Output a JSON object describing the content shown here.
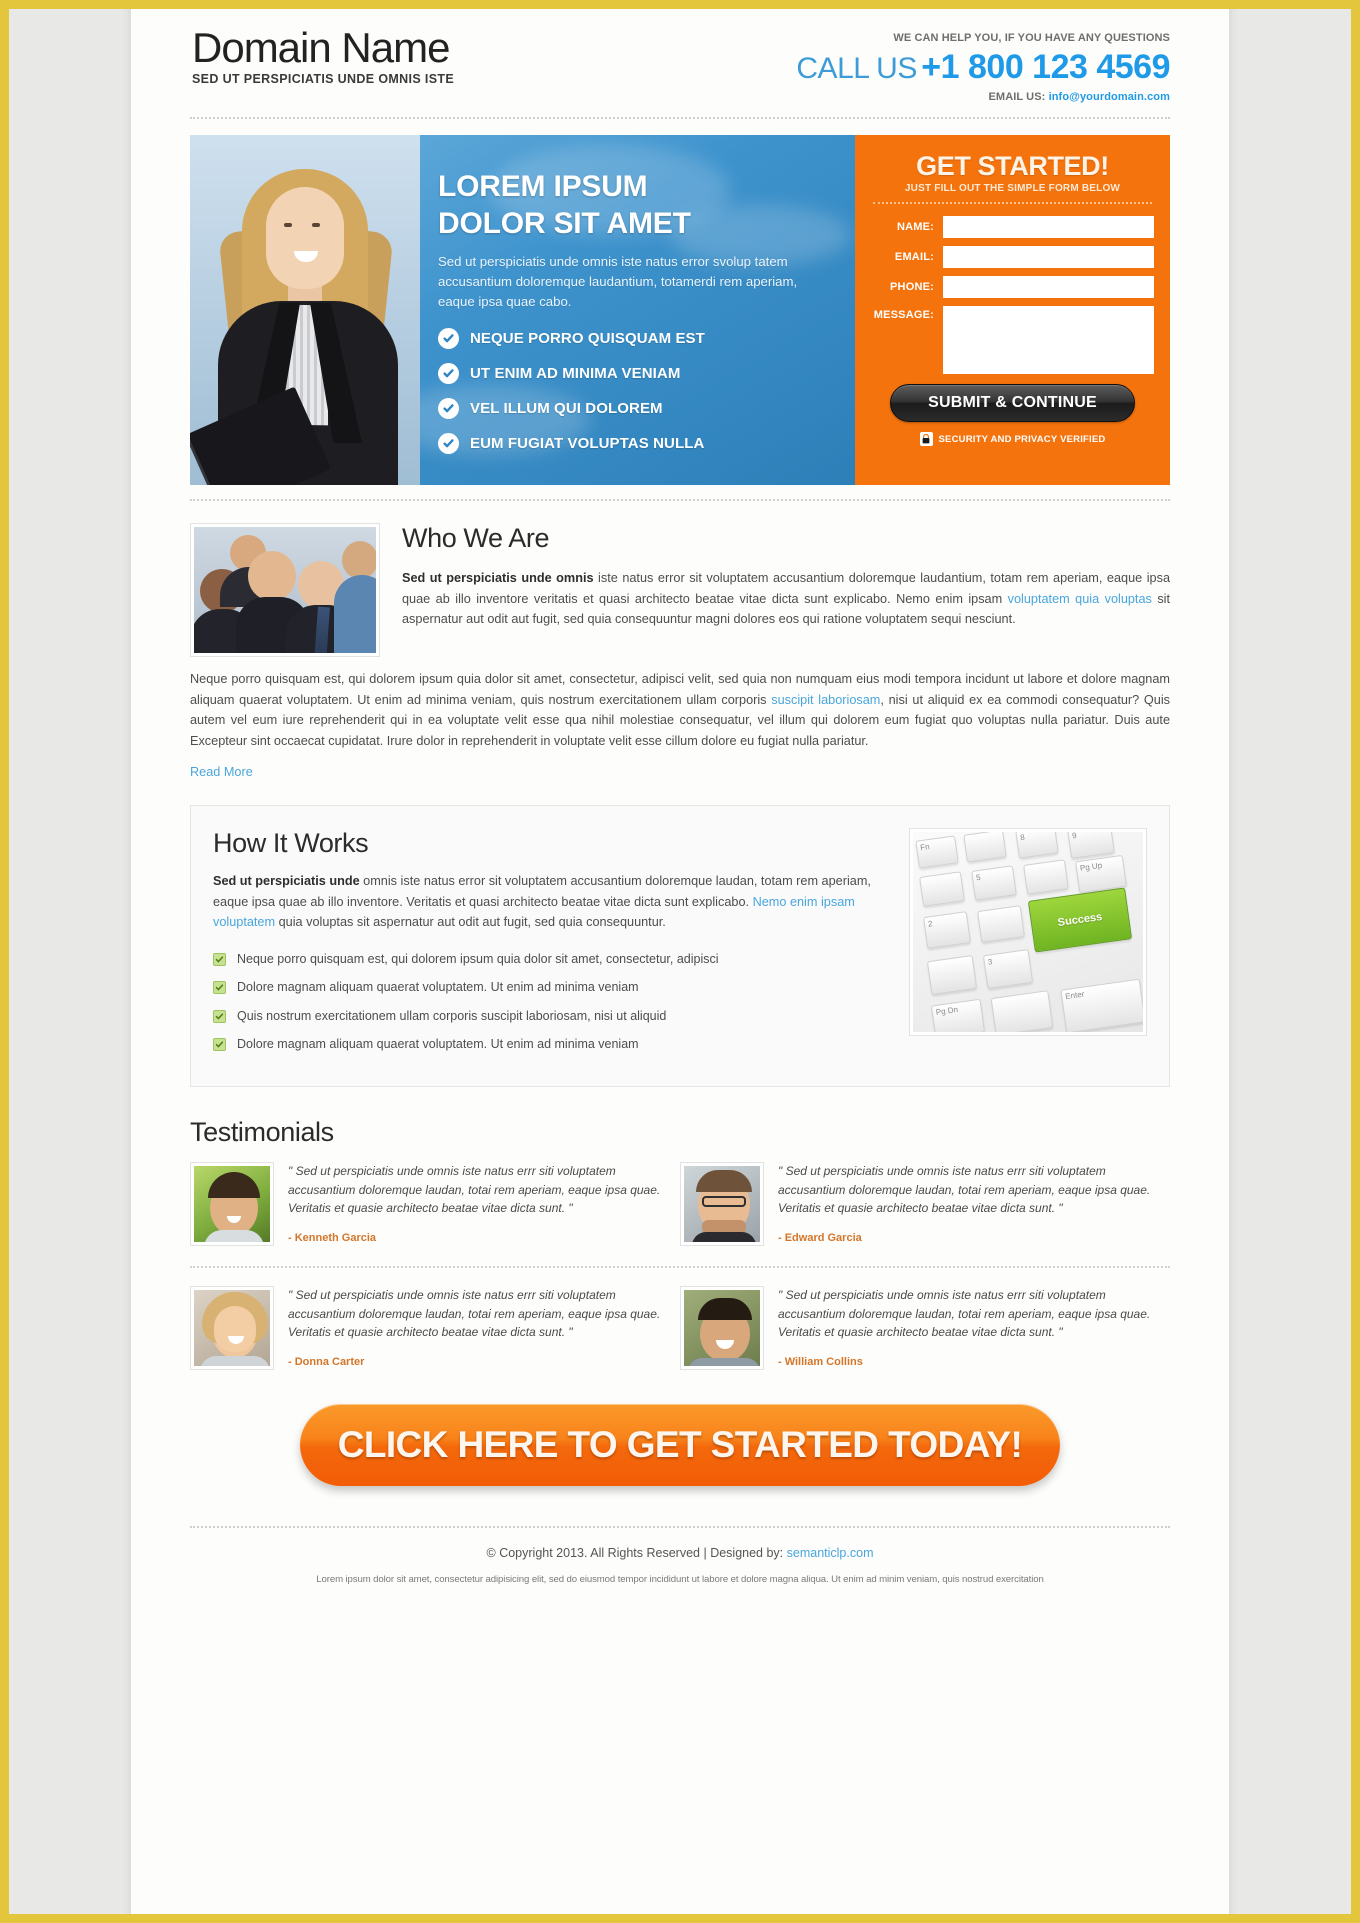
{
  "header": {
    "logo_title": "Domain Name",
    "logo_subtitle": "SED UT PERSPICIATIS UNDE OMNIS ISTE",
    "help_text": "WE CAN HELP YOU, IF YOU HAVE ANY QUESTIONS",
    "call_us_label": "CALL US",
    "phone": "+1 800 123 4569",
    "email_label": "EMAIL US:",
    "email": "info@yourdomain.com"
  },
  "hero": {
    "heading_line1": "LOREM IPSUM",
    "heading_line2": "DOLOR SIT AMET",
    "paragraph": "Sed ut perspiciatis unde omnis iste natus error svolup tatem accusantium doloremque laudantium, totamerdi rem aperiam, eaque ipsa quae cabo.",
    "bullets": [
      "NEQUE PORRO QUISQUAM EST",
      "UT ENIM AD MINIMA VENIAM",
      "VEL ILLUM QUI DOLOREM",
      "EUM FUGIAT VOLUPTAS NULLA"
    ]
  },
  "form": {
    "title": "GET STARTED!",
    "subtitle": "JUST FILL OUT THE SIMPLE FORM BELOW",
    "fields": [
      {
        "label": "NAME:",
        "value": "",
        "placeholder": ""
      },
      {
        "label": "EMAIL:",
        "value": "",
        "placeholder": ""
      },
      {
        "label": "PHONE:",
        "value": "",
        "placeholder": ""
      }
    ],
    "message_label": "MESSAGE:",
    "message_value": "",
    "submit_label": "SUBMIT & CONTINUE",
    "security_text": "SECURITY AND PRIVACY VERIFIED",
    "accent_color": "#f4730d"
  },
  "who_we_are": {
    "title": "Who We Are",
    "para1_bold": "Sed ut perspiciatis unde omnis",
    "para1_a": " iste natus error sit voluptatem accusantium doloremque laudantium, totam rem aperiam, eaque ipsa quae ab illo inventore veritatis et quasi architecto beatae vitae dicta sunt explicabo. Nemo enim ipsam ",
    "para1_link": "voluptatem quia voluptas",
    "para1_b": " sit aspernatur aut odit aut fugit, sed quia consequuntur magni dolores eos qui ratione voluptatem sequi nesciunt.",
    "para2_a": "Neque porro quisquam est, qui dolorem ipsum quia dolor sit amet, consectetur, adipisci velit, sed quia non numquam eius modi tempora incidunt ut labore et dolore magnam aliquam quaerat voluptatem. Ut enim ad minima veniam, quis nostrum exercitationem ullam corporis ",
    "para2_link": "suscipit laboriosam",
    "para2_b": ", nisi ut aliquid ex ea commodi consequatur? Quis autem vel eum iure reprehenderit qui in ea voluptate velit esse qua nihil molestiae consequatur, vel illum qui dolorem eum fugiat quo voluptas nulla pariatur. Duis aute Excepteur sint occaecat cupidatat. Irure dolor in reprehenderit in voluptate velit esse cillum dolore eu fugiat nulla pariatur.",
    "read_more": "Read More"
  },
  "how_it_works": {
    "title": "How It Works",
    "para_bold": "Sed ut perspiciatis unde",
    "para_a": " omnis iste natus error sit voluptatem accusantium doloremque laudan, totam rem aperiam, eaque ipsa quae ab illo inventore. Veritatis et quasi architecto beatae vitae dicta sunt explicabo. ",
    "para_link": "Nemo enim ipsam voluptatem",
    "para_b": " quia voluptas sit aspernatur aut odit aut fugit, sed quia consequuntur.",
    "bullets": [
      "Neque porro quisquam est, qui dolorem ipsum quia dolor sit amet, consectetur, adipisci",
      "Dolore magnam aliquam quaerat voluptatem. Ut enim ad minima veniam",
      "Quis nostrum exercitationem ullam corporis suscipit laboriosam, nisi ut aliquid",
      "Dolore magnam aliquam quaerat voluptatem. Ut enim ad minima veniam"
    ],
    "keyboard_key_label": "Success"
  },
  "testimonials": {
    "title": "Testimonials",
    "items": [
      {
        "quote": "\" Sed ut perspiciatis unde omnis iste natus errr siti voluptatem accusantium doloremque laudan, totai rem aperiam, eaque ipsa quae. Veritatis et quasie architecto beatae vitae dicta sunt. \"",
        "name": "- Kenneth Garcia"
      },
      {
        "quote": "\" Sed ut perspiciatis unde omnis iste natus errr siti voluptatem accusantium doloremque laudan, totai rem aperiam, eaque ipsa quae. Veritatis et quasie architecto beatae vitae dicta sunt. \"",
        "name": "- Edward Garcia"
      },
      {
        "quote": "\" Sed ut perspiciatis unde omnis iste natus errr siti voluptatem accusantium doloremque laudan, totai rem aperiam, eaque ipsa quae. Veritatis et quasie architecto beatae vitae dicta sunt. \"",
        "name": "- Donna Carter"
      },
      {
        "quote": "\" Sed ut perspiciatis unde omnis iste natus errr siti voluptatem accusantium doloremque laudan, totai rem aperiam, eaque ipsa quae. Veritatis et quasie architecto beatae vitae dicta sunt. \"",
        "name": "- William Collins"
      }
    ]
  },
  "cta": {
    "label": "CLICK HERE TO GET STARTED TODAY!"
  },
  "footer": {
    "copyright": "© Copyright 2013. All Rights Reserved  |  Designed by: ",
    "designer_link": "semanticlp.com",
    "disclaimer": "Lorem ipsum dolor sit amet, consectetur adipisicing elit, sed do eiusmod tempor incididunt ut labore et dolore magna aliqua. Ut enim ad minim veniam, quis nostrud exercitation"
  }
}
